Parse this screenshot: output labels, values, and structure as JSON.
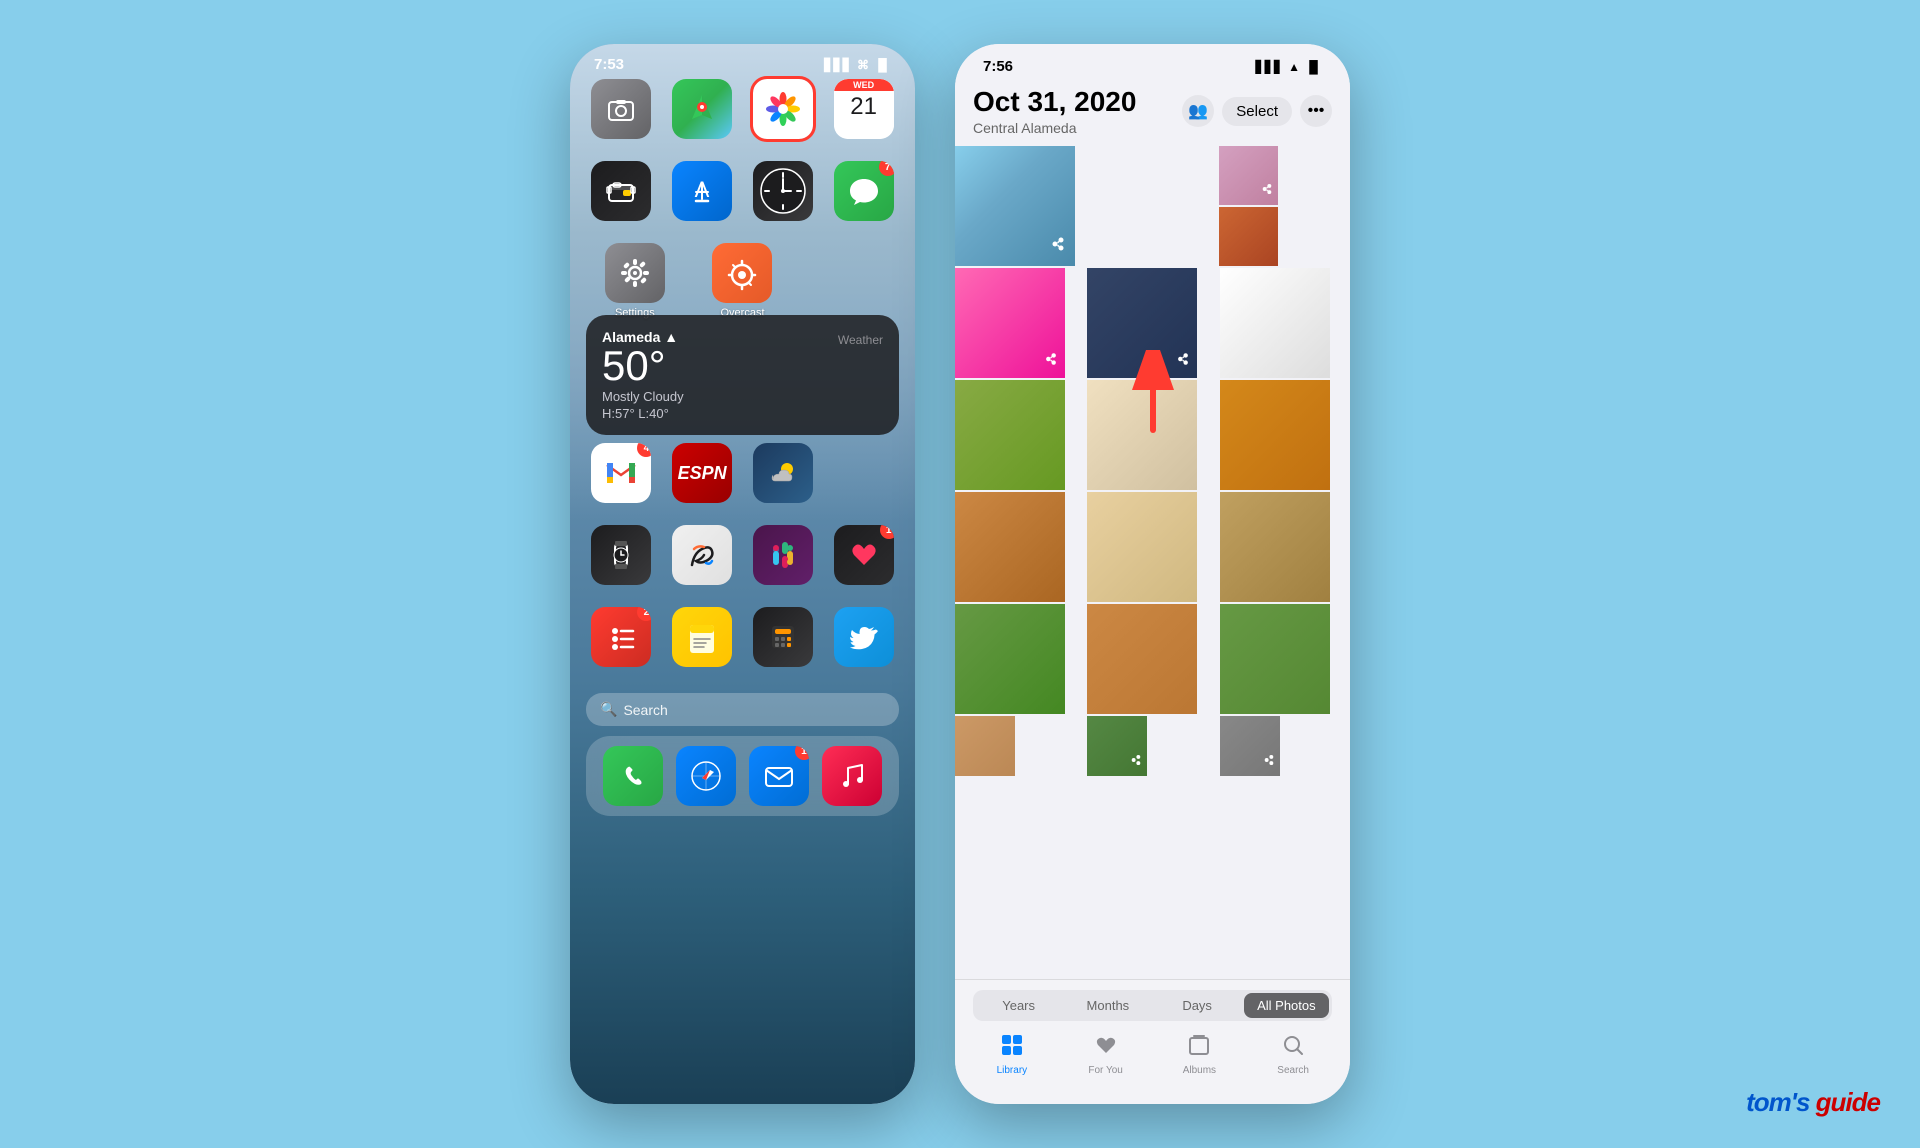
{
  "left_phone": {
    "status": {
      "time": "7:53",
      "location_icon": "▲",
      "signal": "▋▋▋",
      "wifi": "wifi",
      "battery": "🔋"
    },
    "apps_row1": [
      {
        "name": "Camera",
        "color": "camera",
        "badge": null
      },
      {
        "name": "Maps",
        "color": "maps",
        "badge": null
      },
      {
        "name": "Photos",
        "color": "photos",
        "badge": null,
        "highlighted": true
      },
      {
        "name": "Calendar",
        "color": "calendar",
        "badge": null
      }
    ],
    "apps_row2": [
      {
        "name": "Wallet",
        "color": "wallet",
        "badge": null
      },
      {
        "name": "App Store",
        "color": "appstore",
        "badge": null
      },
      {
        "name": "Clock",
        "color": "clock",
        "badge": null
      },
      {
        "name": "Messages",
        "color": "messages",
        "badge": "7"
      }
    ],
    "widget": {
      "city": "Alameda ▲",
      "temp": "50°",
      "condition": "Mostly Cloudy",
      "hi_lo": "H:57° L:40°",
      "app_name": "Weather"
    },
    "apps_row3": [
      {
        "name": "Gmail",
        "color": "gmail",
        "badge": "4"
      },
      {
        "name": "ESPN",
        "color": "espn",
        "badge": null
      },
      {
        "name": "",
        "color": "weather",
        "badge": null
      }
    ],
    "apps_row4": [
      {
        "name": "Watch",
        "color": "watch",
        "badge": null
      },
      {
        "name": "Freeform",
        "color": "freeform",
        "badge": null
      },
      {
        "name": "Slack",
        "color": "slack",
        "badge": null
      },
      {
        "name": "Get Healthy",
        "color": "gethealthy",
        "badge": "1"
      }
    ],
    "apps_row5": [
      {
        "name": "Reminders",
        "color": "reminders",
        "badge": "2"
      },
      {
        "name": "Notes",
        "color": "notes",
        "badge": null
      },
      {
        "name": "Calculator",
        "color": "calculator",
        "badge": null
      },
      {
        "name": "Twitter",
        "color": "twitter",
        "badge": null
      }
    ],
    "search": "🔍 Search",
    "dock": [
      {
        "name": "Phone",
        "color": "green"
      },
      {
        "name": "Safari",
        "color": "blue"
      },
      {
        "name": "Mail",
        "color": "blue",
        "badge": "1"
      },
      {
        "name": "Music",
        "color": "red"
      }
    ]
  },
  "right_phone": {
    "status": {
      "time": "7:56",
      "signal": "▋▋▋",
      "wifi": "wifi",
      "battery": "🔋"
    },
    "header": {
      "date": "Oct 31, 2020",
      "location": "Central Alameda",
      "select_label": "Select",
      "more_label": "•••"
    },
    "segment": {
      "items": [
        "Years",
        "Months",
        "Days",
        "All Photos"
      ],
      "active": "All Photos"
    },
    "tabs": [
      {
        "name": "Library",
        "icon": "📷",
        "active": true
      },
      {
        "name": "For You",
        "icon": "❤️",
        "active": false
      },
      {
        "name": "Albums",
        "icon": "📁",
        "active": false
      },
      {
        "name": "Search",
        "icon": "🔍",
        "active": false
      }
    ]
  },
  "watermark": {
    "brand": "tom's",
    "brand2": "guide"
  }
}
